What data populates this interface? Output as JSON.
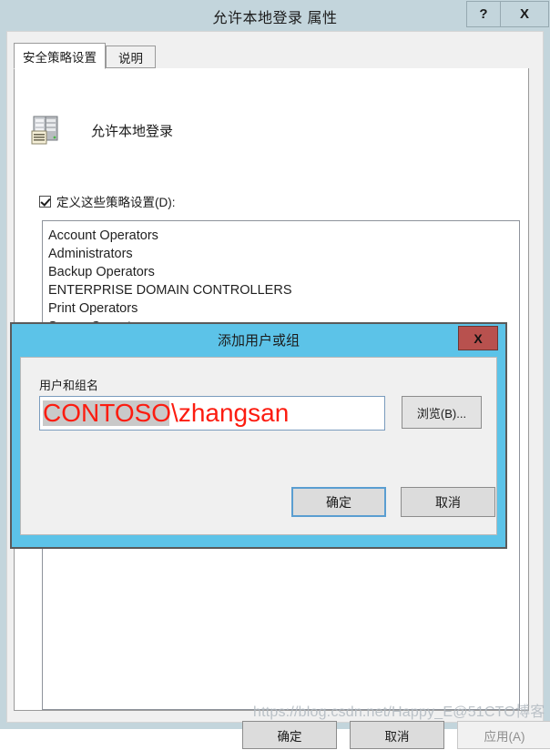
{
  "window": {
    "title": "允许本地登录 属性",
    "help_button": "?",
    "close_button": "X"
  },
  "tabs": [
    {
      "label": "安全策略设置",
      "active": true
    },
    {
      "label": "说明",
      "active": false
    }
  ],
  "policy": {
    "icon": "policy-server-icon",
    "name": "允许本地登录",
    "define_checkbox_label": "定义这些策略设置(D):",
    "define_checkbox_checked": true
  },
  "accounts": [
    "Account Operators",
    "Administrators",
    "Backup Operators",
    "ENTERPRISE DOMAIN CONTROLLERS",
    "Print Operators",
    "Server Operators"
  ],
  "bottom_buttons": {
    "ok": "确定",
    "cancel": "取消",
    "apply": "应用(A)"
  },
  "modal": {
    "title": "添加用户或组",
    "close_button": "X",
    "field_label": "用户和组名",
    "input_value": "CONTOSO\\zhangsan",
    "input_placeholder": "",
    "browse_button": "浏览(B)...",
    "ok_button": "确定",
    "cancel_button": "取消"
  },
  "watermark": "https://blog.csdn.net/Happy_E@51CTO博客",
  "colors": {
    "title_bar": "#c3d5dc",
    "modal_frame": "#5cc3e8",
    "modal_close": "#b8514e",
    "input_text": "#fc1c10",
    "dialog_face": "#f0f0f0"
  }
}
